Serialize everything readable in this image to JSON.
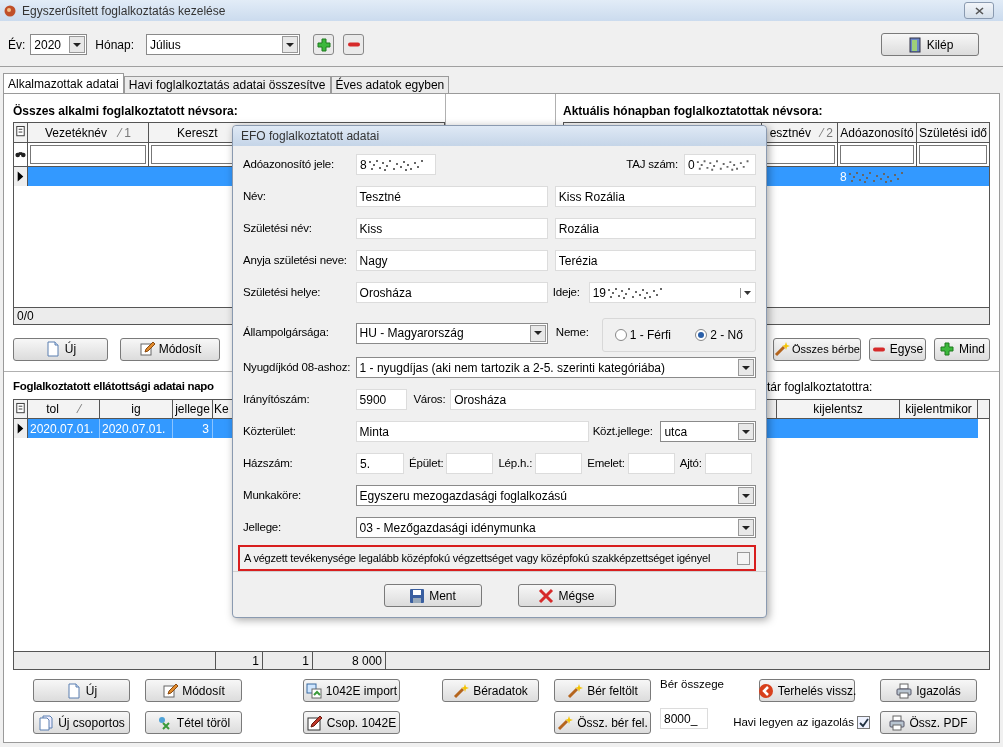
{
  "window": {
    "title": "Egyszerűsített foglalkoztatás kezelése"
  },
  "toolbar": {
    "year_label": "Év:",
    "year": "2020",
    "month_label": "Hónap:",
    "month": "Július",
    "exit_button": "Kilép"
  },
  "tabs": [
    {
      "label": "Alkalmazottak adatai",
      "selected": true
    },
    {
      "label": "Havi foglalkoztatás adatai összesítve",
      "selected": false
    },
    {
      "label": "Éves adatok egyben",
      "selected": false
    }
  ],
  "employees_panel": {
    "title": "Összes alkalmi foglalkoztatott névsora:",
    "columns": [
      {
        "label": "Vezetéknév",
        "sort": "⁄ 1"
      },
      {
        "label": "Kereszt"
      }
    ],
    "rows": [
      {
        "selected": true
      }
    ],
    "count": "0/0"
  },
  "current_panel": {
    "title": "Aktuális hónapban foglalkoztatottak névsora:",
    "columns": [
      {
        "label": "esztnév",
        "sort": "⁄ 2"
      },
      {
        "label": "Adóazonosító"
      },
      {
        "label": "Születési idő"
      }
    ],
    "rows": [
      {
        "selected": true,
        "tax_id": "8"
      }
    ]
  },
  "upper_left_buttons": [
    "Új",
    "Módosít"
  ],
  "upper_right_buttons": [
    "Összes bérbe",
    "Egyse",
    "Mind"
  ],
  "days_panel": {
    "title": "Foglalkoztatott ellátottsági adatai napo",
    "title_right": "tár foglalkoztatottra:",
    "columns": [
      {
        "label": "tol",
        "sort": "⁄"
      },
      {
        "label": "ig"
      },
      {
        "label": "jellege"
      },
      {
        "label": "Ke"
      }
    ],
    "columns_right": [
      "kijelentsz",
      "kijelentmikor"
    ],
    "rows": [
      {
        "selected": true,
        "cells": [
          "2020.07.01.",
          "2020.07.01.",
          "3"
        ]
      }
    ],
    "totals": [
      "1",
      "1",
      "8 000"
    ]
  },
  "bottom_columns": [
    [
      "Új",
      "Új csoportos"
    ],
    [
      "Módosít",
      "Tétel töröl"
    ],
    [
      "1042E import",
      "Csop. 1042E"
    ],
    [
      "Béradatok"
    ],
    [
      "Bér feltölt",
      "Össz. bér fel."
    ]
  ],
  "wage": {
    "label": "Bér összege",
    "value": "8000_"
  },
  "reverse_button": "Terhelés vissz.",
  "monthly_cert": {
    "label": "Havi legyen az igazolás",
    "checked": true
  },
  "print_buttons": [
    "Igazolás",
    "Össz. PDF"
  ],
  "dialog": {
    "title": "EFO foglalkoztatott adatai",
    "tax_id": {
      "label": "Adóazonosító jele:",
      "value": "8"
    },
    "taj": {
      "label": "TAJ szám:",
      "value": "0"
    },
    "name_rows": [
      {
        "label": "Név:",
        "first": "Tesztné",
        "second": "Kiss Rozália"
      },
      {
        "label": "Születési név:",
        "first": "Kiss",
        "second": "Rozália"
      },
      {
        "label": "Anyja születési neve:",
        "first": "Nagy",
        "second": "Terézia"
      }
    ],
    "birthplace": {
      "label": "Születési helye:",
      "value": "Orosháza"
    },
    "birthdate": {
      "label": "Ideje:",
      "value": "19"
    },
    "citizenship": {
      "label": "Állampolgársága:",
      "value": "HU - Magyarország"
    },
    "gender": {
      "label": "Neme:",
      "options": [
        {
          "label": "1 - Férfi",
          "selected": false
        },
        {
          "label": "2 - Nő",
          "selected": true
        }
      ]
    },
    "pension": {
      "label": "Nyugdíjkód 08-ashoz:",
      "value": "1 - nyugdíjas (aki nem tartozik a 2-5. szerinti kategóriába)"
    },
    "zip": {
      "label": "Irányítószám:",
      "value": "5900"
    },
    "city": {
      "label": "Város:",
      "value": "Orosháza"
    },
    "street": {
      "label": "Közterület:",
      "value": "Minta"
    },
    "street_type": {
      "label": "Közt.jellege:",
      "value": "utca"
    },
    "address_parts": [
      {
        "label": "Házszám:",
        "value": "5."
      },
      {
        "label": "Épület:"
      },
      {
        "label": "Lép.h.:"
      },
      {
        "label": "Emelet:"
      },
      {
        "label": "Ajtó:"
      }
    ],
    "job": {
      "label": "Munkaköre:",
      "value": "Egyszeru mezogazdasági foglalkozású"
    },
    "work_type": {
      "label": "Jellege:",
      "value": "03 - Mezőgazdasági idénymunka"
    },
    "qualification": {
      "label": "A végzett tevékenysége legalább középfokú végzettséget vagy középfokú szakképzettséget igényel",
      "checked": false,
      "highlighted": true
    },
    "buttons": [
      "Ment",
      "Mégse"
    ]
  }
}
